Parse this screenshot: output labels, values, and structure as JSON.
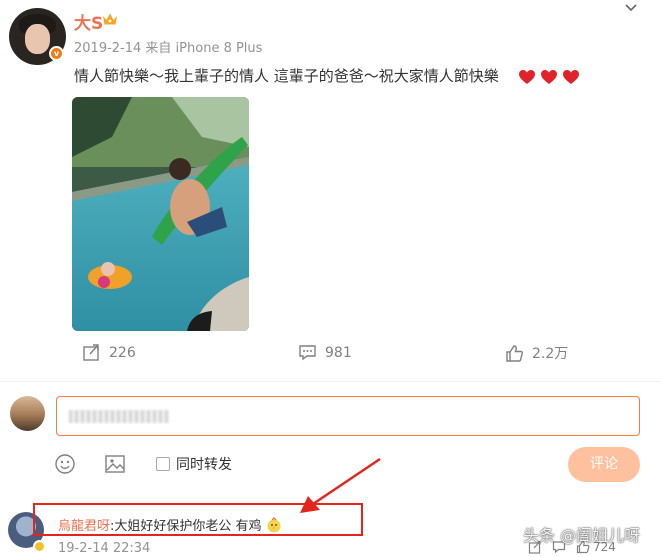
{
  "post": {
    "username": "大S",
    "date": "2019-2-14",
    "source": "来自 iPhone 8 Plus",
    "text": "情人節快樂～我上輩子的情人 這輩子的爸爸～祝大家情人節快樂",
    "heart_count": 3,
    "heart_color": "#e0232b",
    "accent_color": "#eb7350"
  },
  "stats": {
    "reposts": "226",
    "comments": "981",
    "likes": "2.2万"
  },
  "composer": {
    "repost_label": "同时转发",
    "submit_label": "评论",
    "submit_color": "#ffc09f",
    "border_color": "#fa7d3c"
  },
  "comment": {
    "author": "烏龍君呀",
    "separator": ":",
    "text": "大姐好好保护你老公 有鸡",
    "time": "19-2-14 22:34",
    "like_count": "724"
  },
  "watermark": "头条 @阖姐儿呀",
  "annotation_color": "#e3251e"
}
